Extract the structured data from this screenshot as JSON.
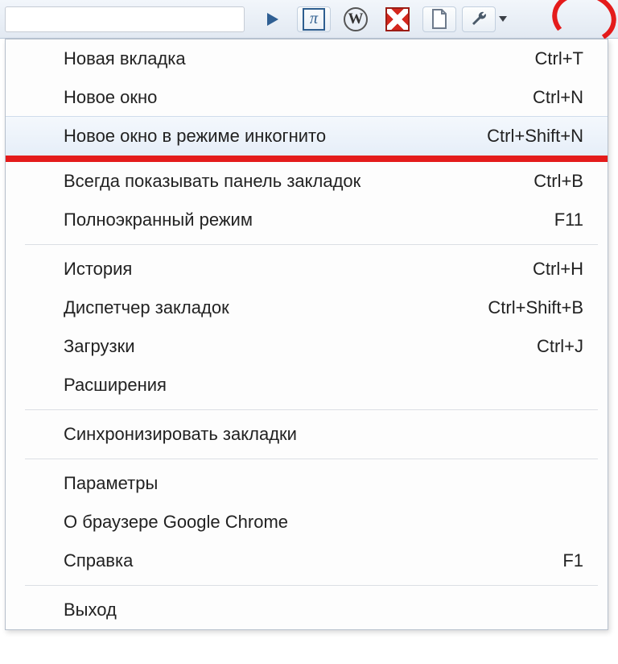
{
  "toolbar": {
    "icons": {
      "play": "play-icon",
      "pi": "pi-icon",
      "wiki": "wikipedia-icon",
      "block": "block-x-icon",
      "page": "new-page-icon",
      "wrench": "wrench-icon"
    },
    "pi_glyph": "π",
    "w_glyph": "W"
  },
  "menu": {
    "groups": [
      [
        {
          "label": "Новая вкладка",
          "shortcut": "Ctrl+T",
          "highlight": false
        },
        {
          "label": "Новое окно",
          "shortcut": "Ctrl+N",
          "highlight": false
        },
        {
          "label": "Новое окно в режиме инкогнито",
          "shortcut": "Ctrl+Shift+N",
          "highlight": true
        }
      ],
      [
        {
          "label": "Всегда показывать панель закладок",
          "shortcut": "Ctrl+B"
        },
        {
          "label": "Полноэкранный режим",
          "shortcut": "F11"
        }
      ],
      [
        {
          "label": "История",
          "shortcut": "Ctrl+H"
        },
        {
          "label": "Диспетчер закладок",
          "shortcut": "Ctrl+Shift+B"
        },
        {
          "label": "Загрузки",
          "shortcut": "Ctrl+J"
        },
        {
          "label": "Расширения",
          "shortcut": ""
        }
      ],
      [
        {
          "label": "Синхронизировать закладки",
          "shortcut": ""
        }
      ],
      [
        {
          "label": "Параметры",
          "shortcut": ""
        },
        {
          "label": "О браузере Google Chrome",
          "shortcut": ""
        },
        {
          "label": "Справка",
          "shortcut": "F1"
        }
      ],
      [
        {
          "label": "Выход",
          "shortcut": ""
        }
      ]
    ],
    "red_separator_after_group": 0
  },
  "annotation": {
    "circle_color": "#e41b1b",
    "underline_color": "#e41b1b"
  }
}
